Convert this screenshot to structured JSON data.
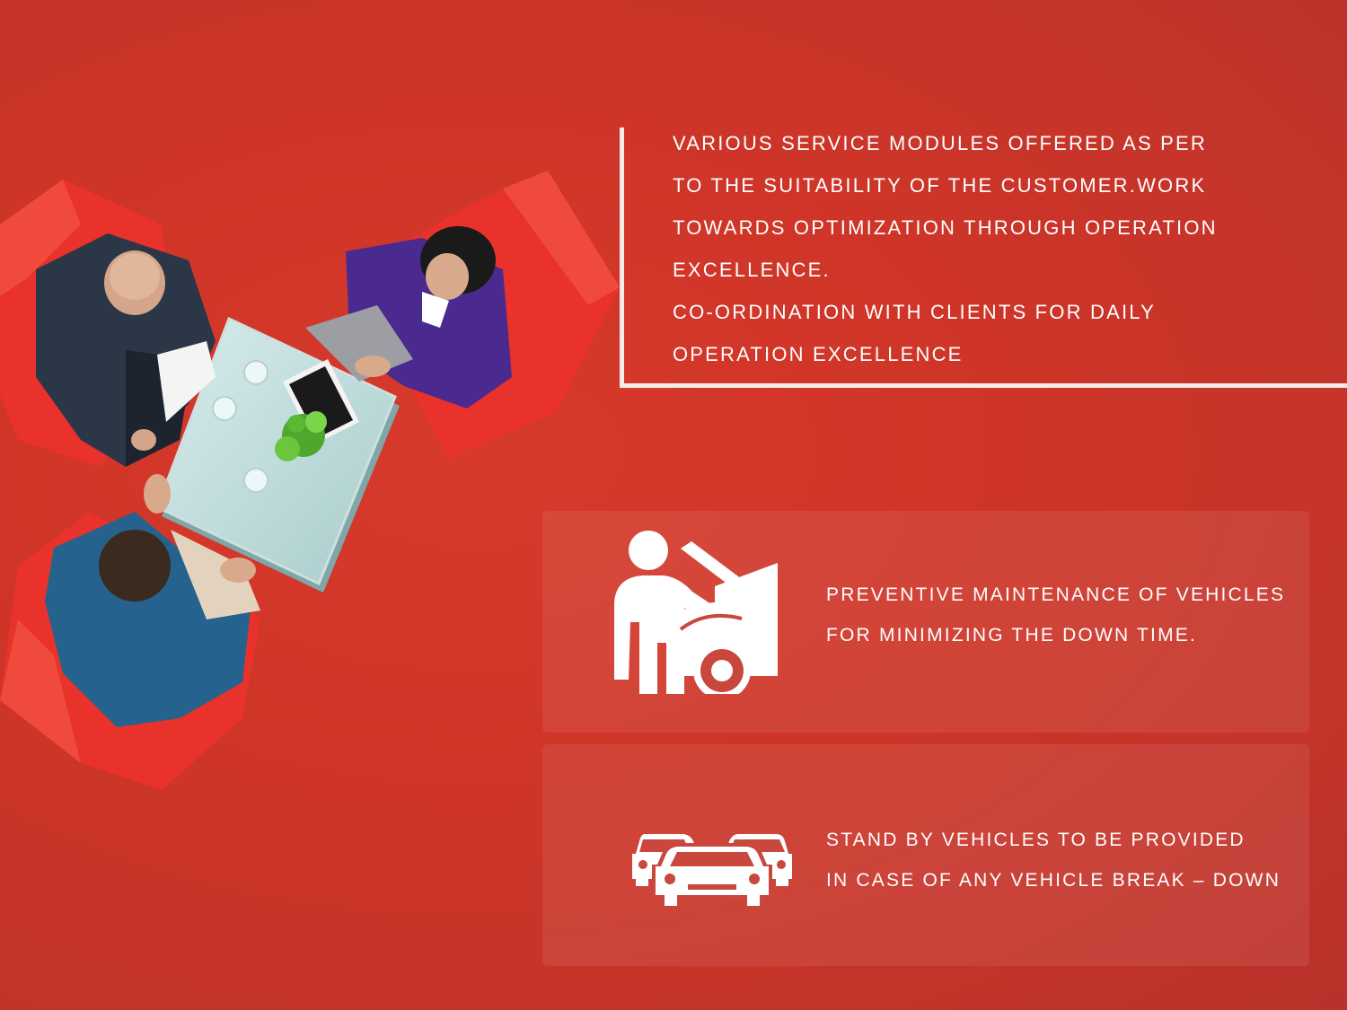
{
  "intro": {
    "lines": [
      "VARIOUS SERVICE MODULES OFFERED AS PER",
      "TO THE SUITABILITY OF THE CUSTOMER.WORK",
      "TOWARDS OPTIMIZATION THROUGH OPERATION",
      "EXCELLENCE.",
      "CO-ORDINATION WITH CLIENTS FOR DAILY",
      "OPERATION EXCELLENCE"
    ]
  },
  "services": [
    {
      "icon": "mechanic-car-repair-icon",
      "lines": [
        "PREVENTIVE MAINTENANCE OF VEHICLES",
        "FOR MINIMIZING THE DOWN TIME."
      ]
    },
    {
      "icon": "standby-cars-icon",
      "lines": [
        "STAND BY VEHICLES TO BE PROVIDED",
        "IN CASE OF ANY VEHICLE BREAK – DOWN"
      ]
    }
  ],
  "colors": {
    "background": "#cf3528",
    "chair": "#e8322b",
    "text": "#ffffff",
    "frame": "#f2ece8"
  }
}
